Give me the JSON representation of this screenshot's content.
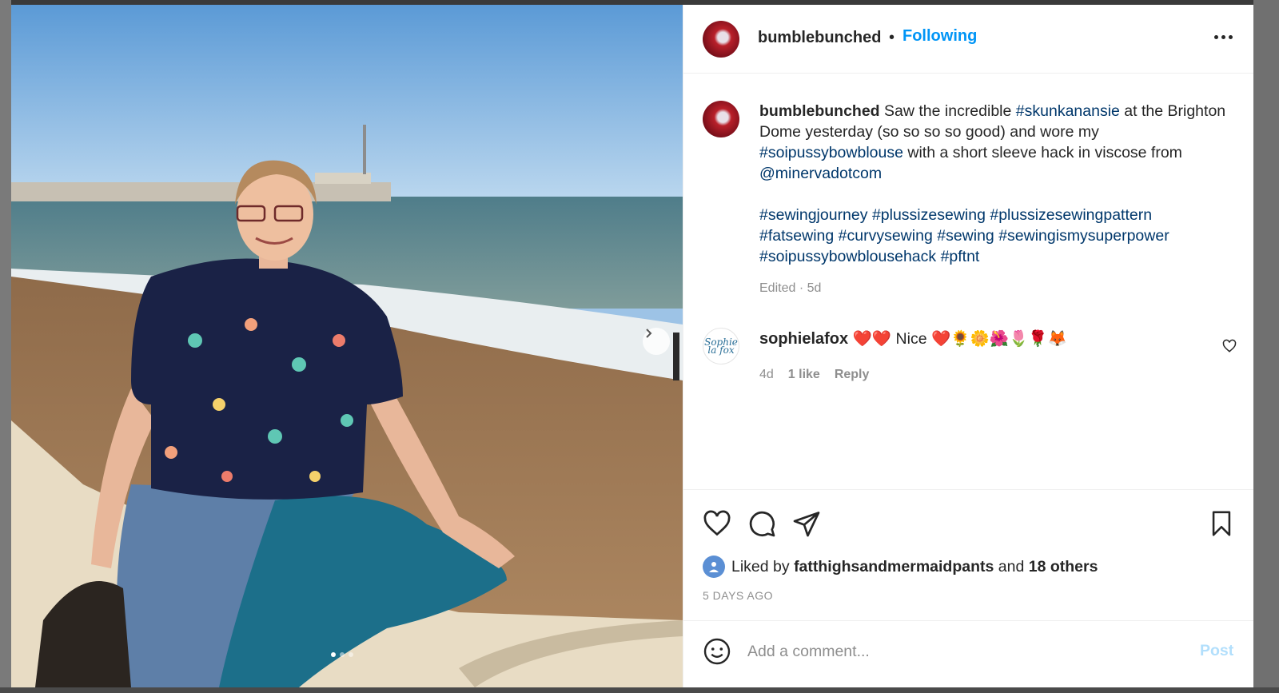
{
  "post": {
    "author": "bumblebunched",
    "separator": "•",
    "follow_label": "Following",
    "more_icon": "more-horizontal-icon"
  },
  "caption": {
    "author": "bumblebunched",
    "text_parts": {
      "p1": " Saw the incredible ",
      "tag1": "#skunkanansie",
      "p2": " at the Brighton Dome yesterday (so so so so good) and wore my ",
      "tag2": "#soipussybowblouse",
      "p3": " with a short sleeve hack in viscose from ",
      "mention": "@minervadotcom"
    },
    "hashtags": [
      "#sewingjourney",
      "#plussizesewing",
      "#plussizesewingpattern",
      "#fatsewing",
      "#curvysewing",
      "#sewing",
      "#sewingismysuperpower",
      "#soipussybowblousehack",
      "#pftnt"
    ],
    "meta": "Edited · 5d"
  },
  "comments": [
    {
      "author": "sophielafox",
      "avatar_text": "Sophie la fox",
      "text": "❤️❤️ Nice ❤️🌻🌼🌺🌷🌹🦊",
      "age": "4d",
      "likes": "1 like",
      "reply_label": "Reply"
    }
  ],
  "likes": {
    "prefix": "Liked by",
    "user": "fatthighsandmermaidpants",
    "mid": "and",
    "others": "18 others"
  },
  "timestamp": "5 DAYS AGO",
  "comment_box": {
    "placeholder": "Add a comment...",
    "post_label": "Post"
  },
  "carousel": {
    "total_slides": 3,
    "current_slide": 1
  },
  "colors": {
    "accent": "#0095f6",
    "link": "#00376b",
    "muted": "#8e8e8e",
    "text": "#262626"
  }
}
